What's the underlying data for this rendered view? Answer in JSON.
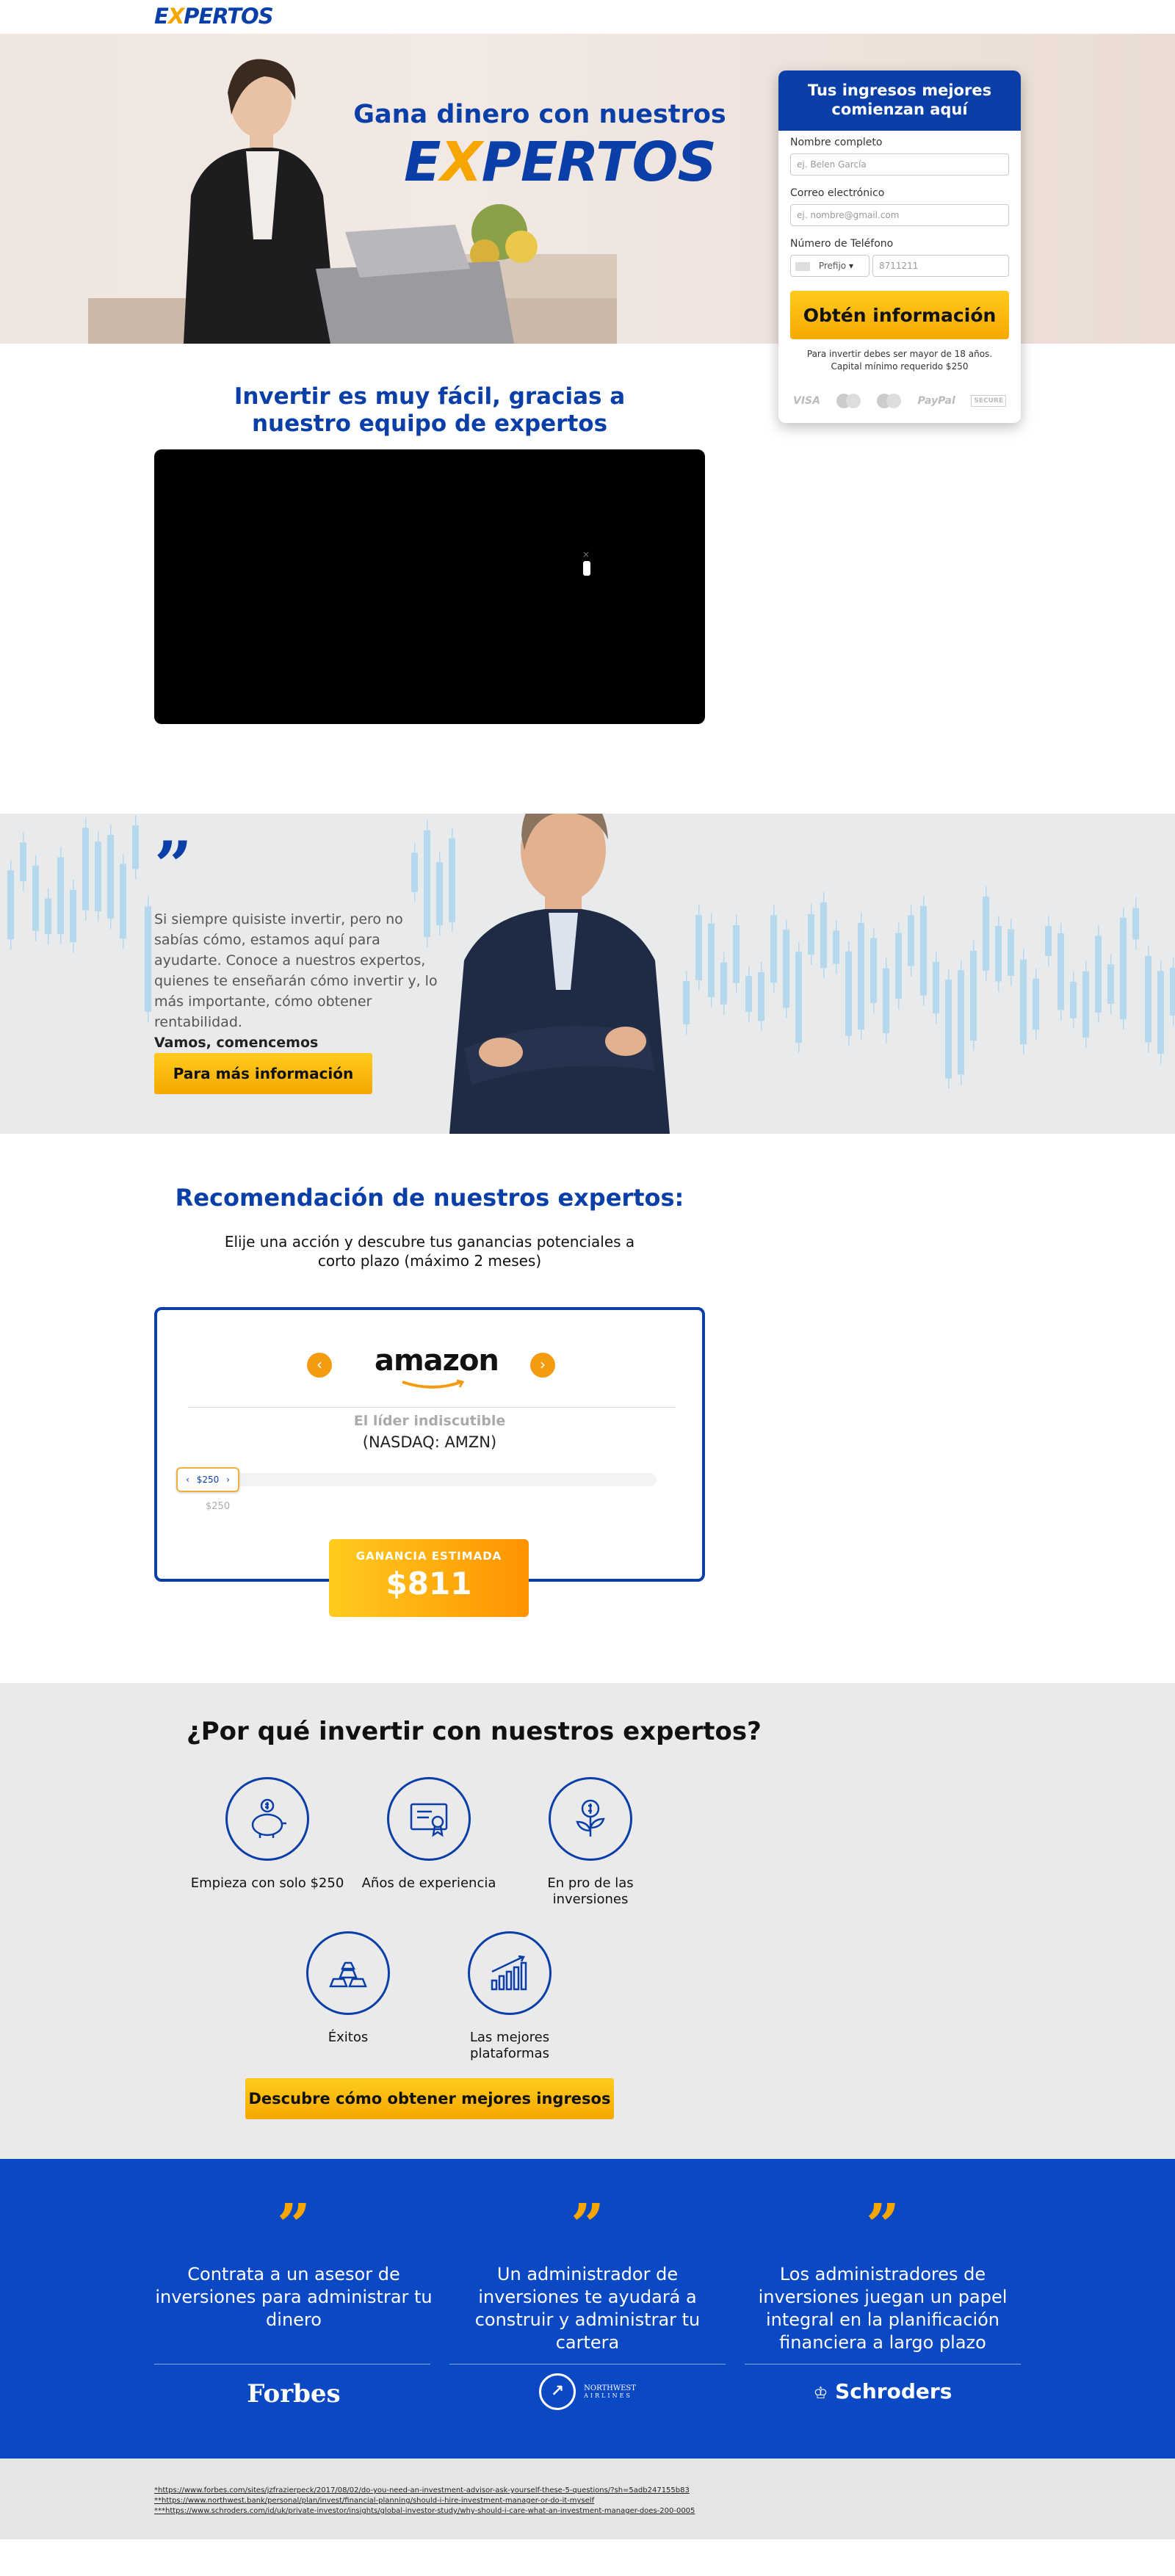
{
  "header": {
    "logo_pre": "E",
    "logo_x": "X",
    "logo_post": "PERTOS"
  },
  "hero": {
    "title": "Gana dinero con nuestros",
    "logo_pre": "E",
    "logo_x": "X",
    "logo_post": "PERTOS"
  },
  "form": {
    "title": "Tus ingresos mejores comienzan aquí",
    "name_label": "Nombre completo",
    "name_placeholder": "ej. Belen García",
    "email_label": "Correo electrónico",
    "email_placeholder": "ej. nombre@gmail.com",
    "phone_label": "Número de Teléfono",
    "prefix_label": "Prefijo",
    "phone_placeholder": "8711211",
    "submit_label": "Obtén información",
    "note": "Para invertir debes ser mayor de 18 años. Capital mínimo requerido $250",
    "payment": [
      "VISA",
      "PayPal",
      "SECURE"
    ]
  },
  "video_section": {
    "title": "Invertir es muy fácil, gracias a nuestro equipo de expertos"
  },
  "quote_section": {
    "text": "Si siempre quisiste invertir, pero no sabías cómo, estamos aquí para ayudarte. Conoce a nuestros expertos, quienes te enseñarán cómo invertir y, lo más importante, cómo obtener rentabilidad.",
    "bold": "Vamos, comencemos",
    "button": "Para más información"
  },
  "recommendation": {
    "title": "Recomendación de nuestros expertos:",
    "subtitle": "Elije una acción y descubre tus ganancias potenciales a corto plazo (máximo 2 meses)",
    "brand": "amazon",
    "tagline": "El líder indiscutible",
    "ticker": "(NASDAQ: AMZN)",
    "slider_value": "$250",
    "slider_min": "$250",
    "slider_level": 0,
    "gain_label": "GANANCIA ESTIMADA",
    "gain_value": "$811"
  },
  "why": {
    "title": "¿Por qué invertir con nuestros expertos?",
    "features": [
      {
        "label": "Empieza con solo $250",
        "icon": "piggy-bank-icon"
      },
      {
        "label": "Años de experiencia",
        "icon": "certificate-icon"
      },
      {
        "label": "En pro de las inversiones",
        "icon": "money-plant-icon"
      },
      {
        "label": "Éxitos",
        "icon": "gold-bars-icon"
      },
      {
        "label": "Las mejores plataformas",
        "icon": "growth-chart-icon"
      }
    ],
    "button": "Descubre cómo obtener mejores ingresos"
  },
  "testimonials": [
    {
      "text": "Contrata a un asesor de inversiones para administrar tu dinero",
      "brand": "Forbes"
    },
    {
      "text": "Un administrador de inversiones te ayudará a construir y administrar tu cartera",
      "brand": "NORTHWEST",
      "brand_sub": "AIRLINES"
    },
    {
      "text": "Los administradores de inversiones juegan un papel integral en la planificación financiera a largo plazo",
      "brand": "Schroders"
    }
  ],
  "footer": {
    "refs": [
      "*https://www.forbes.com/sites/jzfrazierpeck/2017/08/02/do-you-need-an-investment-advisor-ask-yourself-these-5-questions/?sh=5adb247155b83",
      "**https://www.northwest.bank/personal/plan/invest/financial-planning/should-i-hire-investment-manager-or-do-it-myself",
      "***https://www.schroders.com/id/uk/private-investor/insights/global-investor-study/why-should-i-care-what-an-investment-manager-does-200-0005"
    ]
  },
  "colors": {
    "brand_blue": "#0b3fa8",
    "accent_orange": "#f7a600",
    "section_blue": "#0a48c4"
  }
}
